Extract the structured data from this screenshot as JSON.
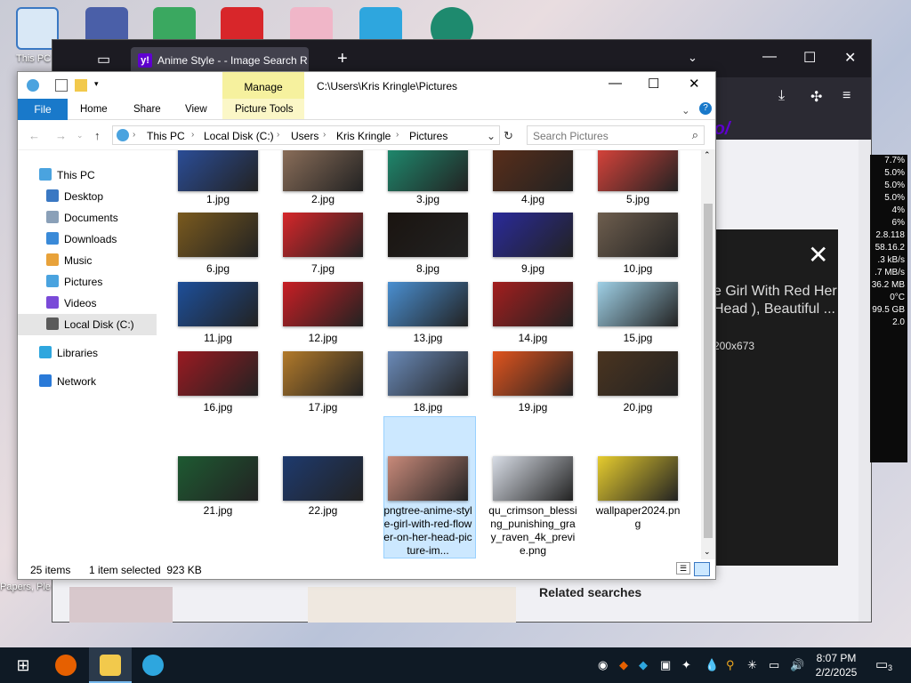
{
  "desktop": {
    "this_pc_label": "This PC",
    "side_label_papers": "Papers, Ple"
  },
  "browser": {
    "tab_title": "Anime Style - - Image Search R",
    "tab_favicon": "y!",
    "new_tab": "+",
    "yahoo_logo": "yahoo/",
    "panel_close": "✕",
    "panel_title": "e Girl With Red Her Head ), Beautiful ...",
    "panel_dims": "200x673",
    "related_searches": "Related searches"
  },
  "gadget": {
    "lines": [
      "7.7%",
      "5.0%",
      "5.0%",
      "5.0%",
      "4%",
      "6%",
      "",
      "2.8.118",
      "58.16.2",
      ".3 kB/s",
      ".7 MB/s",
      "36.2 MB",
      "",
      "",
      "0°C",
      "99.5 GB",
      "2.0"
    ]
  },
  "explorer": {
    "manage_tab": "Manage",
    "title_path": "C:\\Users\\Kris Kringle\\Pictures",
    "ribbon": {
      "file": "File",
      "home": "Home",
      "share": "Share",
      "view": "View",
      "picture_tools": "Picture Tools"
    },
    "address": {
      "crumbs": [
        "This PC",
        "Local Disk (C:)",
        "Users",
        "Kris Kringle",
        "Pictures"
      ]
    },
    "search_placeholder": "Search Pictures",
    "nav": [
      {
        "label": "This PC",
        "icon": "computer-icon"
      },
      {
        "label": "Desktop",
        "icon": "desktop-folder-icon"
      },
      {
        "label": "Documents",
        "icon": "documents-folder-icon"
      },
      {
        "label": "Downloads",
        "icon": "downloads-folder-icon"
      },
      {
        "label": "Music",
        "icon": "music-folder-icon"
      },
      {
        "label": "Pictures",
        "icon": "pictures-folder-icon"
      },
      {
        "label": "Videos",
        "icon": "videos-folder-icon"
      },
      {
        "label": "Local Disk (C:)",
        "icon": "drive-icon"
      },
      {
        "label": "Libraries",
        "icon": "libraries-icon"
      },
      {
        "label": "Network",
        "icon": "network-icon"
      }
    ],
    "files": [
      {
        "name": "1.jpg",
        "color": "#2b4e9a"
      },
      {
        "name": "2.jpg",
        "color": "#8c6f5a"
      },
      {
        "name": "3.jpg",
        "color": "#1e8a6e"
      },
      {
        "name": "4.jpg",
        "color": "#5a2e1a"
      },
      {
        "name": "5.jpg",
        "color": "#d9433b"
      },
      {
        "name": "6.jpg",
        "color": "#7a5a1e"
      },
      {
        "name": "7.jpg",
        "color": "#d6262a"
      },
      {
        "name": "8.jpg",
        "color": "#1a1410"
      },
      {
        "name": "9.jpg",
        "color": "#2a2a9a"
      },
      {
        "name": "10.jpg",
        "color": "#6e5e4e"
      },
      {
        "name": "11.jpg",
        "color": "#1d4f9a"
      },
      {
        "name": "12.jpg",
        "color": "#c81e24"
      },
      {
        "name": "13.jpg",
        "color": "#4a8fd1"
      },
      {
        "name": "14.jpg",
        "color": "#a31e1e"
      },
      {
        "name": "15.jpg",
        "color": "#9fd0e6"
      },
      {
        "name": "16.jpg",
        "color": "#9a1a22"
      },
      {
        "name": "17.jpg",
        "color": "#b27a2a"
      },
      {
        "name": "18.jpg",
        "color": "#6a8ab8"
      },
      {
        "name": "19.jpg",
        "color": "#e0541e"
      },
      {
        "name": "20.jpg",
        "color": "#4a3420"
      },
      {
        "name": "21.jpg",
        "color": "#1e5a32"
      },
      {
        "name": "22.jpg",
        "color": "#1e3a6e"
      },
      {
        "name": "pngtree-anime-style-girl-with-red-flower-on-her-head-picture-im...",
        "color": "#c98a7a"
      },
      {
        "name": "qu_crimson_blessing_punishing_gray_raven_4k_previe.png",
        "color": "#d8dde6"
      },
      {
        "name": "wallpaper2024.png",
        "color": "#e6cc2e"
      }
    ],
    "status": {
      "count": "25 items",
      "selection": "1 item selected  923 KB"
    }
  },
  "taskbar": {
    "time": "8:07 PM",
    "date": "2/2/2025",
    "notification_count": "3"
  }
}
